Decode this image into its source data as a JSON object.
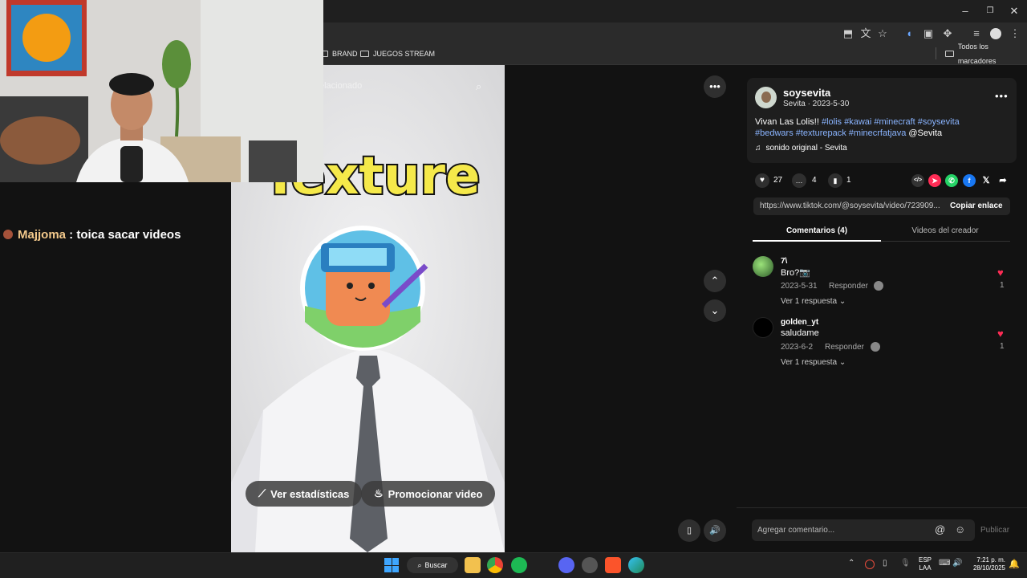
{
  "browser": {
    "bookmarks": [
      {
        "label": "BRAND"
      },
      {
        "label": "JUEGOS STREAM"
      }
    ],
    "all_bookmarks_label": "Todos los marcadores",
    "window_controls": {
      "minimize": "–",
      "restore": "❐",
      "close": "✕"
    }
  },
  "chat": {
    "username": "Majjoma",
    "separator": " : ",
    "message": "toica sacar videos"
  },
  "video": {
    "search_placeholder": "elacionado",
    "overlay_text": "Texture",
    "stats_button": "Ver estadísticas",
    "promote_button": "Promocionar video"
  },
  "post": {
    "author": "soysevita",
    "subline": "Sevita · 2023-5-30",
    "caption_text": "Vivan Las Lolis!! ",
    "hashtags_line1": "#lolis #kawai #minecraft #soysevita",
    "hashtags_line2": "#bedwars #texturepack #minecrfatjava",
    "mention": " @Sevita",
    "sound": "sonido original - Sevita",
    "likes": "27",
    "comments": "4",
    "saves": "1",
    "link": "https://www.tiktok.com/@soysevita/video/723909...",
    "copy_link": "Copiar enlace"
  },
  "tabs": [
    {
      "label": "Comentarios (4)",
      "active": true
    },
    {
      "label": "Videos del creador",
      "active": false
    }
  ],
  "comments": [
    {
      "user": "7\\",
      "text": "Bro?📷",
      "date": "2023-5-31",
      "reply": "Responder",
      "likes": "1",
      "view_replies": "Ver 1 respuesta"
    },
    {
      "user": "golden_yt",
      "text": "saludame",
      "date": "2023-6-2",
      "reply": "Responder",
      "likes": "1",
      "view_replies": "Ver 1 respuesta"
    }
  ],
  "comment_input": {
    "placeholder": "Agregar comentario...",
    "publish": "Publicar"
  },
  "taskbar": {
    "search_label": "Buscar",
    "language": "ESP",
    "keyboard": "LAA",
    "time": "7:21 p. m.",
    "date": "28/10/2025"
  },
  "colors": {
    "accent_pink": "#fe2c55",
    "hashtag_blue": "#8ab4ff",
    "chat_user": "#f3c98b"
  }
}
